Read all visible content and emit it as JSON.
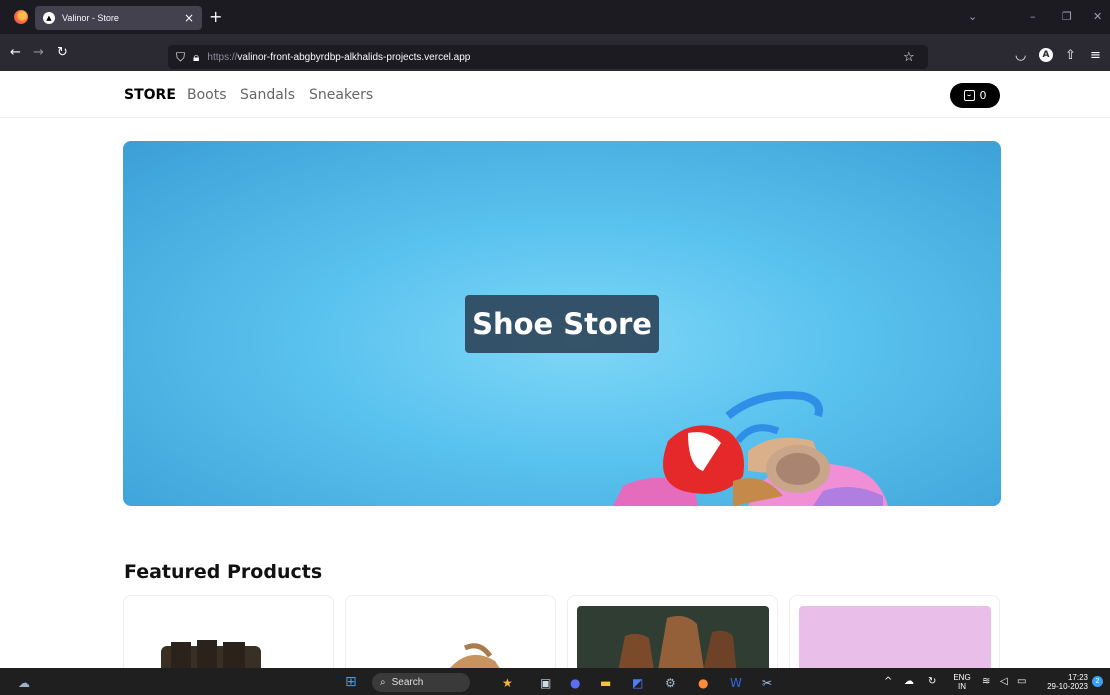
{
  "browser": {
    "tab_title": "Valinor - Store",
    "tab_close": "×",
    "new_tab": "+",
    "url_scheme": "https://",
    "url_host": "valinor-front-abgbyrdbp-alkhalids-projects.vercel.app"
  },
  "site": {
    "brand": "STORE",
    "nav": [
      "Boots",
      "Sandals",
      "Sneakers"
    ],
    "cart_count": "0",
    "hero_title": "Shoe Store",
    "featured_title": "Featured Products"
  },
  "taskbar": {
    "search_label": "Search",
    "lang_top": "ENG",
    "lang_bottom": "IN",
    "time": "17:23",
    "date": "29-10-2023",
    "notif_count": "2"
  },
  "colors": {
    "hero_blue": "#5bc3ef",
    "card3_bg": "#2f3d32",
    "card4_bg": "#e9bfea"
  }
}
